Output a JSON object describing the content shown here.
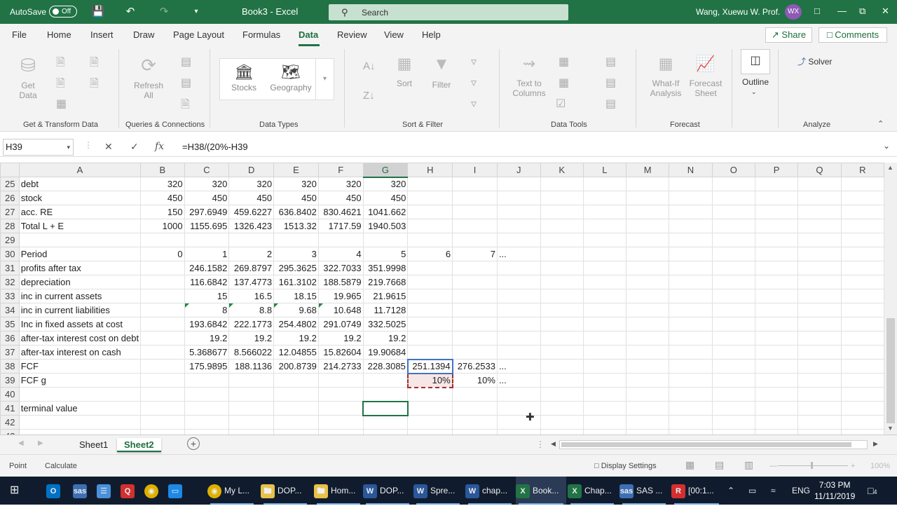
{
  "titlebar": {
    "autosave_label": "AutoSave",
    "autosave_state": "Off",
    "doc_title": "Book3  -  Excel",
    "search_placeholder": "Search",
    "user_name": "Wang, Xuewu W. Prof.",
    "avatar_initials": "WX"
  },
  "menu": {
    "items": [
      "File",
      "Home",
      "Insert",
      "Draw",
      "Page Layout",
      "Formulas",
      "Data",
      "Review",
      "View",
      "Help"
    ],
    "active": "Data",
    "share": "Share",
    "comments": "Comments"
  },
  "ribbon": {
    "get_data": "Get Data",
    "refresh_all": "Refresh All",
    "stocks": "Stocks",
    "geography": "Geography",
    "sort": "Sort",
    "filter": "Filter",
    "text_to_columns": "Text to Columns",
    "what_if": "What-If Analysis",
    "forecast_sheet": "Forecast Sheet",
    "outline": "Outline",
    "solver": "Solver",
    "groups": {
      "get_transform": "Get & Transform Data",
      "queries": "Queries & Connections",
      "data_types": "Data Types",
      "sort_filter": "Sort & Filter",
      "data_tools": "Data Tools",
      "forecast": "Forecast",
      "analyze": "Analyze"
    }
  },
  "formula_bar": {
    "name_box": "H39",
    "formula": "=H38/(20%-H39"
  },
  "sheet": {
    "columns": [
      "A",
      "B",
      "C",
      "D",
      "E",
      "F",
      "G",
      "H",
      "I",
      "J",
      "K",
      "L",
      "M",
      "N",
      "O",
      "P",
      "Q",
      "R"
    ],
    "rows": [
      {
        "n": "25",
        "cells": [
          "debt",
          "320",
          "320",
          "320",
          "320",
          "320",
          "320",
          "",
          "",
          ""
        ]
      },
      {
        "n": "26",
        "cells": [
          "stock",
          "450",
          "450",
          "450",
          "450",
          "450",
          "450",
          "",
          "",
          ""
        ]
      },
      {
        "n": "27",
        "cells": [
          "acc. RE",
          "150",
          "297.6949",
          "459.6227",
          "636.8402",
          "830.4621",
          "1041.662",
          "",
          "",
          ""
        ]
      },
      {
        "n": "28",
        "cells": [
          "Total L + E",
          "1000",
          "1155.695",
          "1326.423",
          "1513.32",
          "1717.59",
          "1940.503",
          "",
          "",
          ""
        ]
      },
      {
        "n": "29",
        "cells": [
          "",
          "",
          "",
          "",
          "",
          "",
          "",
          "",
          "",
          ""
        ]
      },
      {
        "n": "30",
        "cells": [
          "Period",
          "0",
          "1",
          "2",
          "3",
          "4",
          "5",
          "6",
          "7",
          "..."
        ]
      },
      {
        "n": "31",
        "cells": [
          "profits after tax",
          "",
          "246.1582",
          "269.8797",
          "295.3625",
          "322.7033",
          "351.9998",
          "",
          "",
          ""
        ]
      },
      {
        "n": "32",
        "cells": [
          "depreciation",
          "",
          "116.6842",
          "137.4773",
          "161.3102",
          "188.5879",
          "219.7668",
          "",
          "",
          ""
        ]
      },
      {
        "n": "33",
        "cells": [
          "inc in current assets",
          "",
          "15",
          "16.5",
          "18.15",
          "19.965",
          "21.9615",
          "",
          "",
          ""
        ]
      },
      {
        "n": "34",
        "cells": [
          "inc in current liabilities",
          "",
          "8",
          "8.8",
          "9.68",
          "10.648",
          "11.7128",
          "",
          "",
          ""
        ]
      },
      {
        "n": "35",
        "cells": [
          "Inc in fixed assets at cost",
          "",
          "193.6842",
          "222.1773",
          "254.4802",
          "291.0749",
          "332.5025",
          "",
          "",
          ""
        ]
      },
      {
        "n": "36",
        "cells": [
          "after-tax interest cost on debt",
          "",
          "19.2",
          "19.2",
          "19.2",
          "19.2",
          "19.2",
          "",
          "",
          ""
        ]
      },
      {
        "n": "37",
        "cells": [
          "after-tax interest on cash",
          "",
          "5.368677",
          "8.566022",
          "12.04855",
          "15.82604",
          "19.90684",
          "",
          "",
          ""
        ]
      },
      {
        "n": "38",
        "cells": [
          "FCF",
          "",
          "175.9895",
          "188.1136",
          "200.8739",
          "214.2733",
          "228.3085",
          "251.1394",
          "276.2533",
          "..."
        ]
      },
      {
        "n": "39",
        "cells": [
          "FCF g",
          "",
          "",
          "",
          "",
          "",
          "",
          "10%",
          "10%",
          "..."
        ]
      },
      {
        "n": "40",
        "cells": [
          "",
          "",
          "",
          "",
          "",
          "",
          "",
          "",
          "",
          ""
        ]
      },
      {
        "n": "41",
        "cells": [
          "terminal value",
          "",
          "",
          "",
          "",
          "",
          "",
          "",
          "",
          ""
        ]
      },
      {
        "n": "42",
        "cells": [
          "",
          "",
          "",
          "",
          "",
          "",
          "",
          "",
          "",
          ""
        ]
      },
      {
        "n": "43",
        "cells": [
          "",
          "",
          "",
          "",
          "",
          "",
          "",
          "",
          "",
          ""
        ]
      }
    ],
    "edit_formula_prefix": "=",
    "edit_ref1": "H38",
    "edit_mid": "/(20%-",
    "edit_ref2": "H39"
  },
  "tabs": [
    "Sheet1",
    "Sheet2"
  ],
  "active_tab": "Sheet2",
  "status": {
    "mode": "Point",
    "calculate": "Calculate",
    "display_settings": "Display Settings",
    "zoom": "100%"
  },
  "taskbar": {
    "items": [
      "My L...",
      "DOP...",
      "Hom...",
      "DOP...",
      "Spre...",
      "chap...",
      "Book...",
      "Chap...",
      "SAS ...",
      "[00:1..."
    ],
    "lang": "ENG",
    "time": "7:03 PM",
    "date": "11/11/2019",
    "notifications": "4"
  }
}
